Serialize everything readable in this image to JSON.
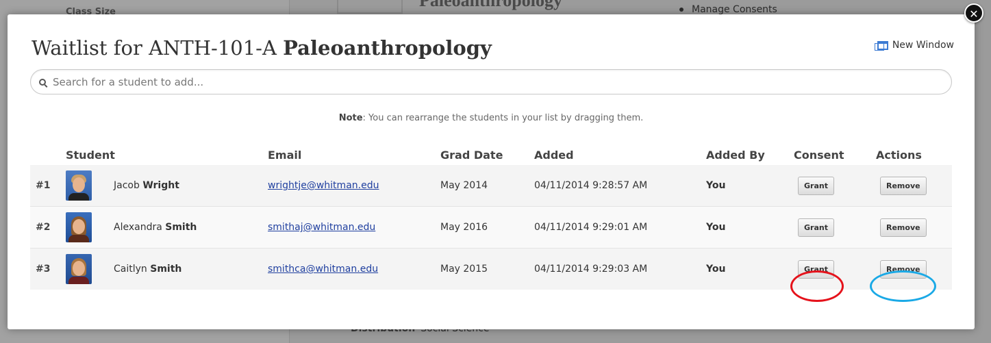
{
  "background": {
    "course_heading": "Paleoanthropology",
    "left_label": "Class Size",
    "bullet_item": "Manage Consents",
    "distribution_label": "Distribution",
    "distribution_value": "Social Science"
  },
  "modal": {
    "title_prefix": "Waitlist for ANTH-101-A",
    "title_course": "Paleoanthropology",
    "new_window_label": "New Window",
    "search_placeholder": "Search for a student to add...",
    "note_label": "Note",
    "note_text": ": You can rearrange the students in your list by dragging them.",
    "close_symbol": "✕"
  },
  "table": {
    "headers": {
      "student": "Student",
      "email": "Email",
      "grad_date": "Grad Date",
      "added": "Added",
      "added_by": "Added By",
      "consent": "Consent",
      "actions": "Actions"
    },
    "rows": [
      {
        "rank": "#1",
        "first": "Jacob",
        "last": "Wright",
        "email": "wrightje@whitman.edu",
        "grad_date": "May 2014",
        "added": "04/11/2014 9:28:57 AM",
        "added_by": "You",
        "consent_btn": "Grant",
        "action_btn": "Remove"
      },
      {
        "rank": "#2",
        "first": "Alexandra",
        "last": "Smith",
        "email": "smithaj@whitman.edu",
        "grad_date": "May 2016",
        "added": "04/11/2014 9:29:01 AM",
        "added_by": "You",
        "consent_btn": "Grant",
        "action_btn": "Remove"
      },
      {
        "rank": "#3",
        "first": "Caitlyn",
        "last": "Smith",
        "email": "smithca@whitman.edu",
        "grad_date": "May 2015",
        "added": "04/11/2014 9:29:03 AM",
        "added_by": "You",
        "consent_btn": "Grant",
        "action_btn": "Remove"
      }
    ]
  },
  "colors": {
    "highlight_grant": "#e5121b",
    "highlight_remove": "#1aa9e6",
    "link": "#1f3f9f"
  },
  "icons": {
    "search": "search-icon",
    "new_window": "new-window-icon",
    "close": "close-icon"
  }
}
